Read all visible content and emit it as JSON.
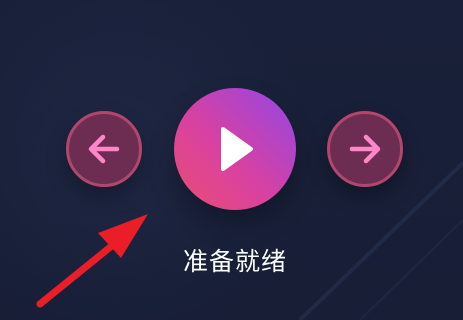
{
  "player": {
    "status_text": "准备就绪",
    "controls": {
      "previous_icon": "arrow-left-icon",
      "play_icon": "play-icon",
      "next_icon": "arrow-right-icon"
    }
  },
  "annotation": {
    "arrow_icon": "red-arrow-icon"
  },
  "colors": {
    "background": "#181f38",
    "nav_button_fill": "#6d2d52",
    "nav_button_border": "#b2466f",
    "nav_icon": "#ff86c8",
    "play_gradient_start": "#9147e7",
    "play_gradient_end": "#eb4d72",
    "annotation_arrow": "#e91e28",
    "status_text": "#ffffff"
  }
}
